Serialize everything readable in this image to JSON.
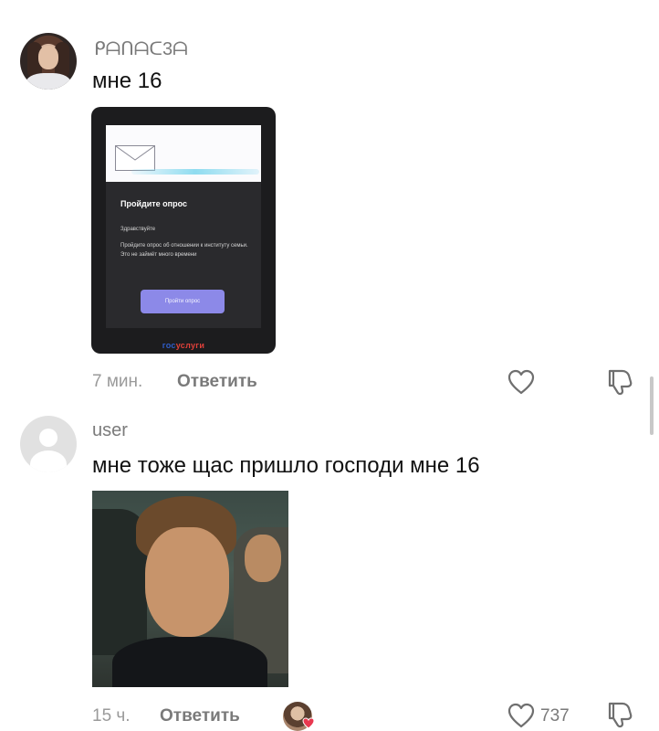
{
  "comments": [
    {
      "username": "ᑭᗩᑎᗩᑕ3ᗩ",
      "text": "мне 16",
      "time": "7 мин.",
      "reply_label": "Ответить",
      "attachment": {
        "title": "Пройдите опрос",
        "greeting": "Здравствуйте",
        "body": "Пройдите опрос об отношении к институту семьи. Это не займёт много времени",
        "button": "Пройти опрос",
        "logo_part1": "гос",
        "logo_part2": "услуги"
      }
    },
    {
      "username": "user",
      "text": "мне тоже щас пришло господи мне 16",
      "time": "15 ч.",
      "reply_label": "Ответить",
      "like_count": "737"
    }
  ],
  "colors": {
    "text": "#111111",
    "muted": "#9a9a9a",
    "accent_button": "#8c89e8",
    "liked_heart": "#e8384f"
  }
}
